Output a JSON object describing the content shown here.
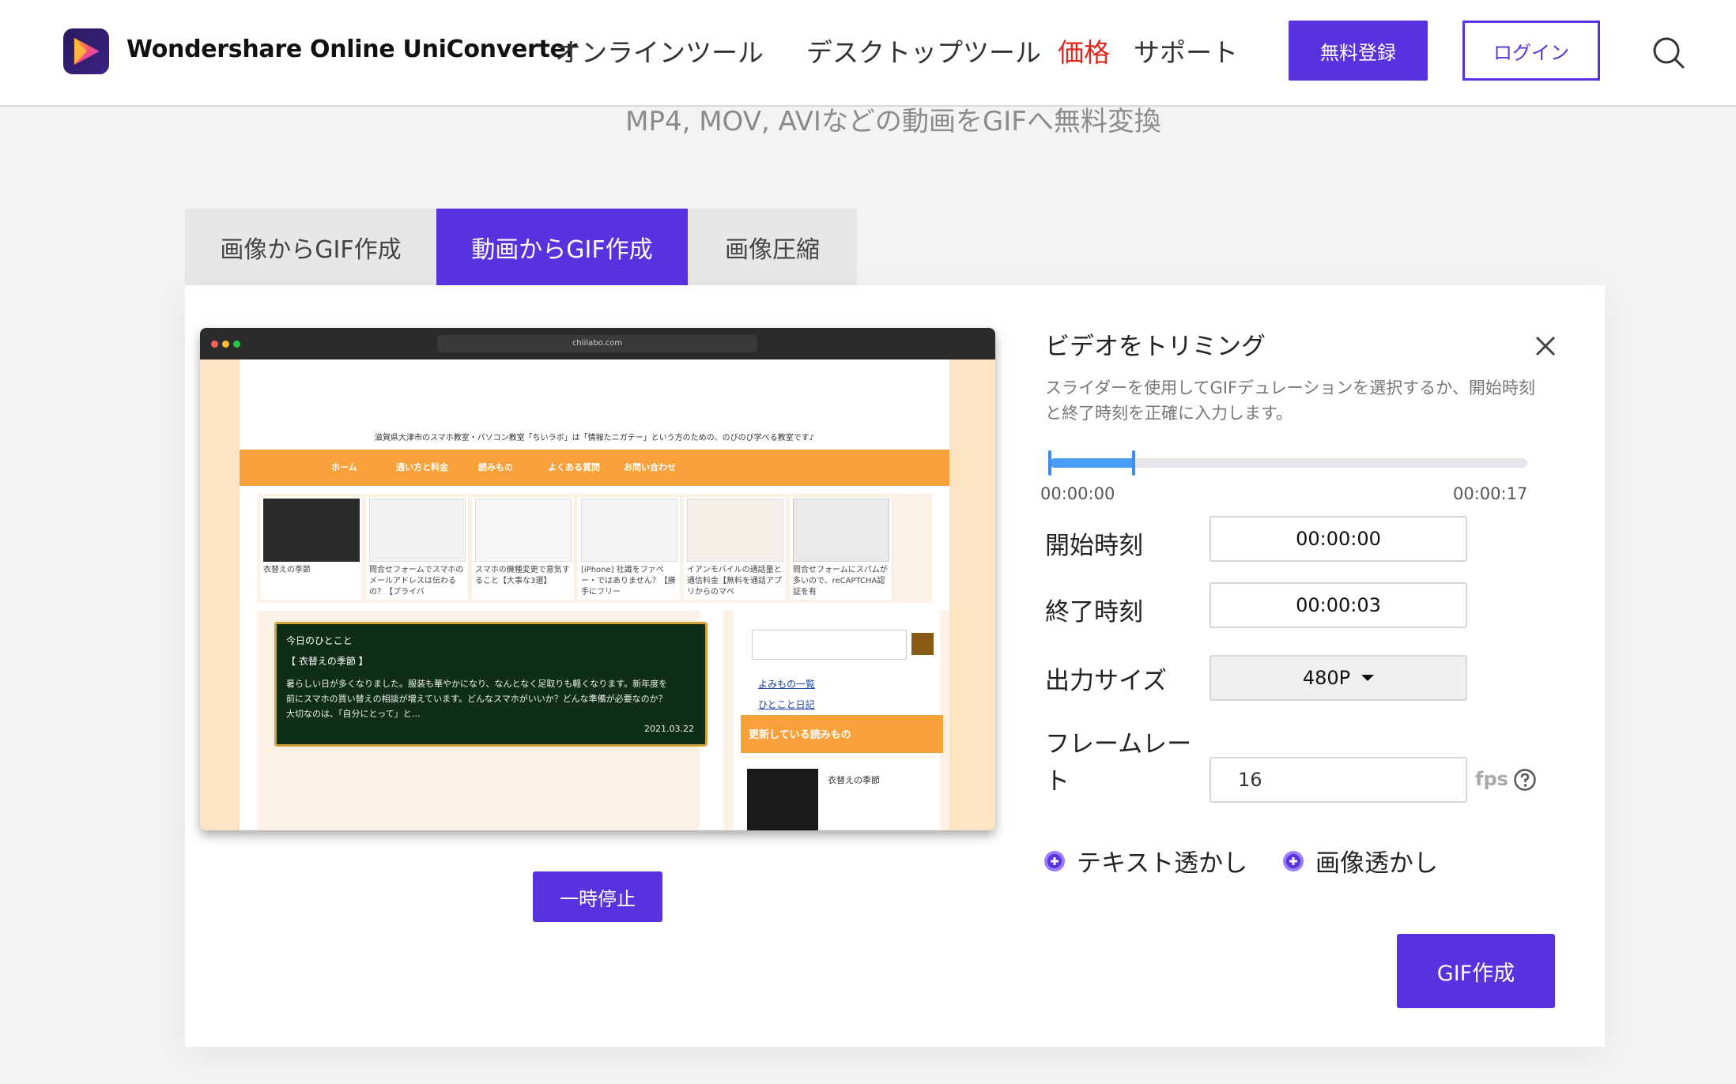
{
  "header": {
    "brand": "Wondershare Online UniConverter",
    "nav": [
      "オンラインツール",
      "デスクトップツール",
      "価格",
      "サポート"
    ],
    "register_label": "無料登録",
    "login_label": "ログイン"
  },
  "subtitle": "MP4, MOV, AVIなどの動画をGIFへ無料変換",
  "tabs": [
    {
      "label": "画像からGIF作成",
      "active": false
    },
    {
      "label": "動画からGIF作成",
      "active": true
    },
    {
      "label": "画像圧縮",
      "active": false
    }
  ],
  "preview": {
    "url": "chiilabo.com",
    "site_tagline": "滋賀県大津市のスマホ教室・パソコン教室「ちいラボ」は「情報たニガテー」という方のための、のびのび学べる教室です♪",
    "site_nav": [
      "ホーム",
      "通い方と料金",
      "読みもの",
      "よくある質問",
      "お問い合わせ"
    ],
    "thumbs": [
      "衣替えの季節",
      "問合せフォームでスマホのメールアドレスは伝わるの？【プライバ",
      "スマホの機種変更で意気すること【大事な3選】",
      "[iPhone] 社識をファペー・ではありません？【勝手にフリー",
      "イアンモバイルの通話量と通信料金【無料を通話アプリからのマペ",
      "問合せフォームにスパムが多いので、reCAPTCHA認証を有"
    ],
    "board_title": "今日のひとこと",
    "board_subtitle": "【 衣替えの季節 】",
    "board_text": "暑らしい日が多くなりました。服装も華やかになり、なんとなく足取りも軽くなります。新年度を前にスマホの買い替えの相談が増えています。どんなスマホがいいか？どんな準備が必要なのか？大切なのは、「自分にとって」と…",
    "board_date": "2021.03.22",
    "side_links": [
      "よみもの一覧",
      "ひとこと日記"
    ],
    "side_head": "更新している読みもの",
    "side_thumb_caption": "衣替えの季節"
  },
  "pause_label": "一時停止",
  "trim": {
    "title": "ビデオをトリミング",
    "description": "スライダーを使用してGIFデュレーションを選択するか、開始時刻と終了時刻を正確に入力します。",
    "range_start": "00:00:00",
    "range_end": "00:00:17",
    "selection_fraction": 0.176,
    "start_label": "開始時刻",
    "start_value": "00:00:00",
    "end_label": "終了時刻",
    "end_value": "00:00:03",
    "size_label": "出力サイズ",
    "size_value": "480P",
    "fps_label_line1": "フレームレー",
    "fps_label_line2": "ト",
    "fps_value": "16",
    "fps_unit": "fps",
    "text_watermark": "テキスト透かし",
    "image_watermark": "画像透かし",
    "create_label": "GIF作成"
  },
  "colors": {
    "accent": "#5932e0",
    "price": "#e3241b",
    "slider": "#4a9ef6"
  }
}
